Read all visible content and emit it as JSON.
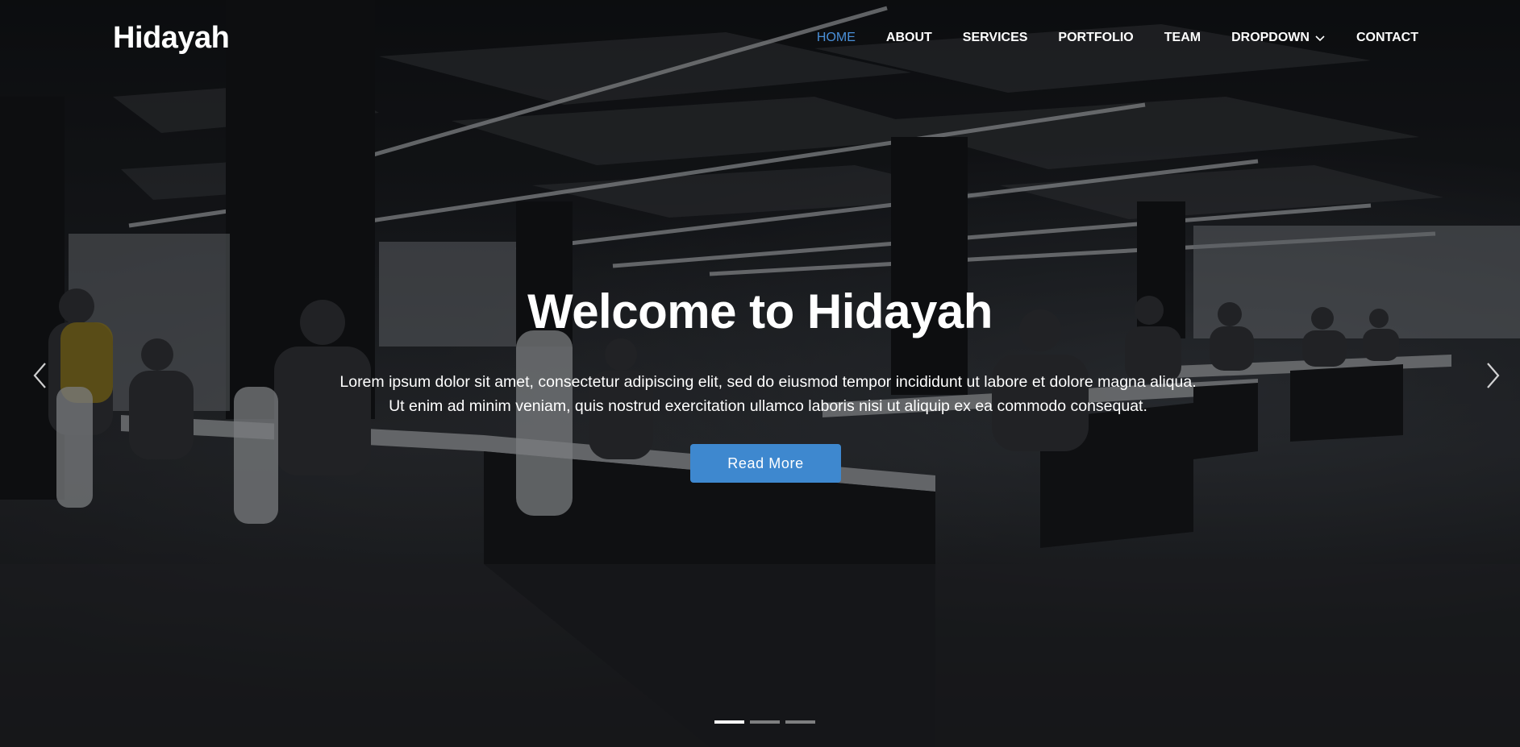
{
  "header": {
    "logo": "Hidayah",
    "nav": [
      {
        "label": "HOME",
        "active": true
      },
      {
        "label": "ABOUT"
      },
      {
        "label": "SERVICES"
      },
      {
        "label": "PORTFOLIO"
      },
      {
        "label": "TEAM"
      },
      {
        "label": "DROPDOWN",
        "icon": "chevron-down-icon"
      },
      {
        "label": "CONTACT"
      }
    ]
  },
  "hero": {
    "title": "Welcome to Hidayah",
    "description": "Lorem ipsum dolor sit amet, consectetur adipiscing elit, sed do eiusmod tempor incididunt ut labore et dolore magna aliqua. Ut enim ad minim veniam, quis nostrud exercitation ullamco laboris nisi ut aliquip ex ea commodo consequat.",
    "button_label": "Read More"
  },
  "carousel": {
    "prev_icon": "chevron-left-icon",
    "next_icon": "chevron-right-icon",
    "slide_count": 3,
    "active_index": 0
  },
  "colors": {
    "accent": "#3e88cf",
    "nav_active": "#4a90d9",
    "text": "#ffffff"
  }
}
